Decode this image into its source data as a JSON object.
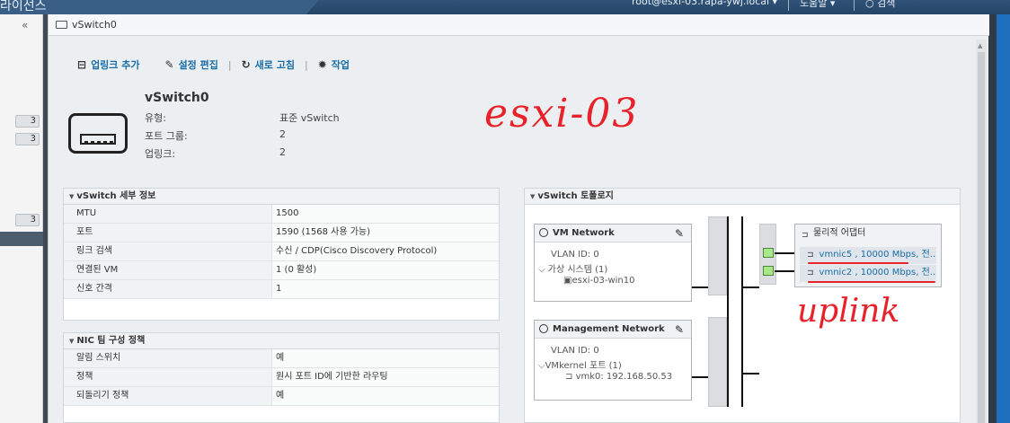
{
  "topbar": {
    "brand": "라이선스",
    "user": "root@esxi-03.rapa-ywj.local ▾",
    "help": "도움말 ▾",
    "search": "○ 검색"
  },
  "leftnav": {
    "collapse": "«",
    "badges": [
      "3",
      "3",
      "3"
    ]
  },
  "window": {
    "title": "vSwitch0"
  },
  "toolbar": {
    "add_uplink": "업링크 추가",
    "edit_settings": "설정 편집",
    "refresh": "새로 고침",
    "actions": "작업"
  },
  "summary": {
    "name": "vSwitch0",
    "type_label": "유형:",
    "type_value": "표준 vSwitch",
    "portgroups_label": "포트 그룹:",
    "portgroups_value": "2",
    "uplinks_label": "업링크:",
    "uplinks_value": "2"
  },
  "annotations": {
    "host": "esxi-03",
    "uplink": "uplink"
  },
  "details": {
    "title": "vSwitch 세부 정보",
    "rows": [
      {
        "key": "MTU",
        "value": "1500"
      },
      {
        "key": "포트",
        "value": "1590 (1568 사용 가능)"
      },
      {
        "key": "링크 검색",
        "value": "수신 / CDP(Cisco Discovery Protocol)"
      },
      {
        "key": "연결된 VM",
        "value": "1 (0 활성)"
      },
      {
        "key": "신호 간격",
        "value": "1"
      }
    ]
  },
  "nic_teaming": {
    "title": "NIC 팀 구성 정책",
    "rows": [
      {
        "key": "알림 스위치",
        "value": "예"
      },
      {
        "key": "정책",
        "value": "원시 포트 ID에 기반한 라우팅"
      },
      {
        "key": "되돌리기 정책",
        "value": "예"
      }
    ]
  },
  "topology": {
    "title": "vSwitch 토폴로지",
    "vm_network": {
      "name": "VM Network",
      "vlan": "VLAN ID: 0",
      "vms": "가상 시스템 (1)",
      "vm": "esxi-03-win10"
    },
    "mgmt_network": {
      "name": "Management Network",
      "vlan": "VLAN ID: 0",
      "vmkernel": "VMkernel 포트 (1)",
      "vmk": "vmk0: 192.168.50.53"
    },
    "adapters": {
      "title": "물리적 어댑터",
      "nics": [
        "vmnic5 , 10000 Mbps, 전...",
        "vmnic2 , 10000 Mbps, 전..."
      ]
    }
  }
}
